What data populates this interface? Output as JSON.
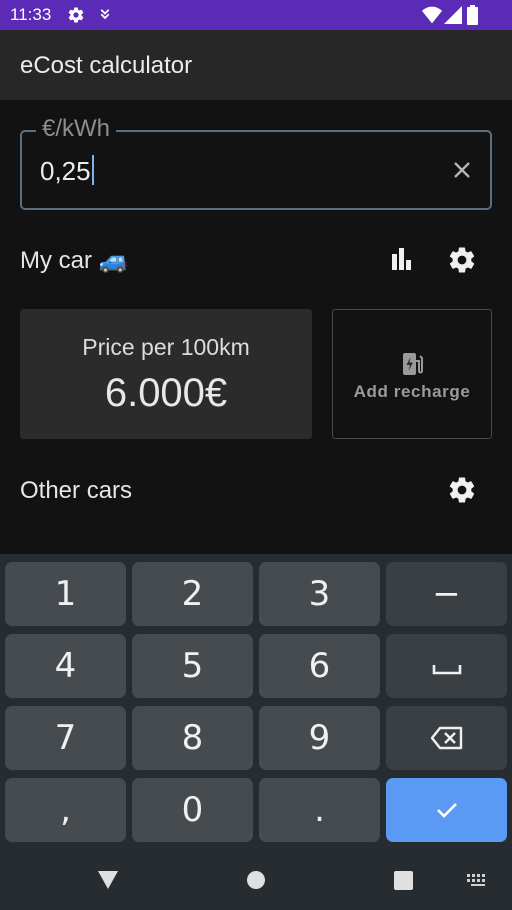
{
  "status_bar": {
    "time": "11:33",
    "left_icons": [
      "gear-icon",
      "location-icon"
    ],
    "right_icons": [
      "wifi-icon",
      "signal-icon",
      "battery-icon"
    ]
  },
  "app_bar": {
    "title": "eCost calculator"
  },
  "price_field": {
    "label": "€/kWh",
    "value": "0,25"
  },
  "my_car": {
    "label": "My car 🚙"
  },
  "price_card": {
    "label": "Price per 100km",
    "value": "6.000€"
  },
  "recharge": {
    "label": "Add recharge"
  },
  "other_cars": {
    "label": "Other cars"
  },
  "keyboard": {
    "rows": [
      [
        "1",
        "2",
        "3",
        "−"
      ],
      [
        "4",
        "5",
        "6",
        "space"
      ],
      [
        "7",
        "8",
        "9",
        "backspace"
      ],
      [
        ",",
        "0",
        ".",
        "done"
      ]
    ],
    "keys": {
      "k1": "1",
      "k2": "2",
      "k3": "3",
      "minus": "−",
      "k4": "4",
      "k5": "5",
      "k6": "6",
      "k7": "7",
      "k8": "8",
      "k9": "9",
      "comma": ",",
      "k0": "0",
      "period": "."
    }
  },
  "colors": {
    "status_bar": "#5b2bb8",
    "app_bar": "#272727",
    "background": "#121212",
    "enter_key": "#5b9af4",
    "field_border": "#5a6e80"
  }
}
